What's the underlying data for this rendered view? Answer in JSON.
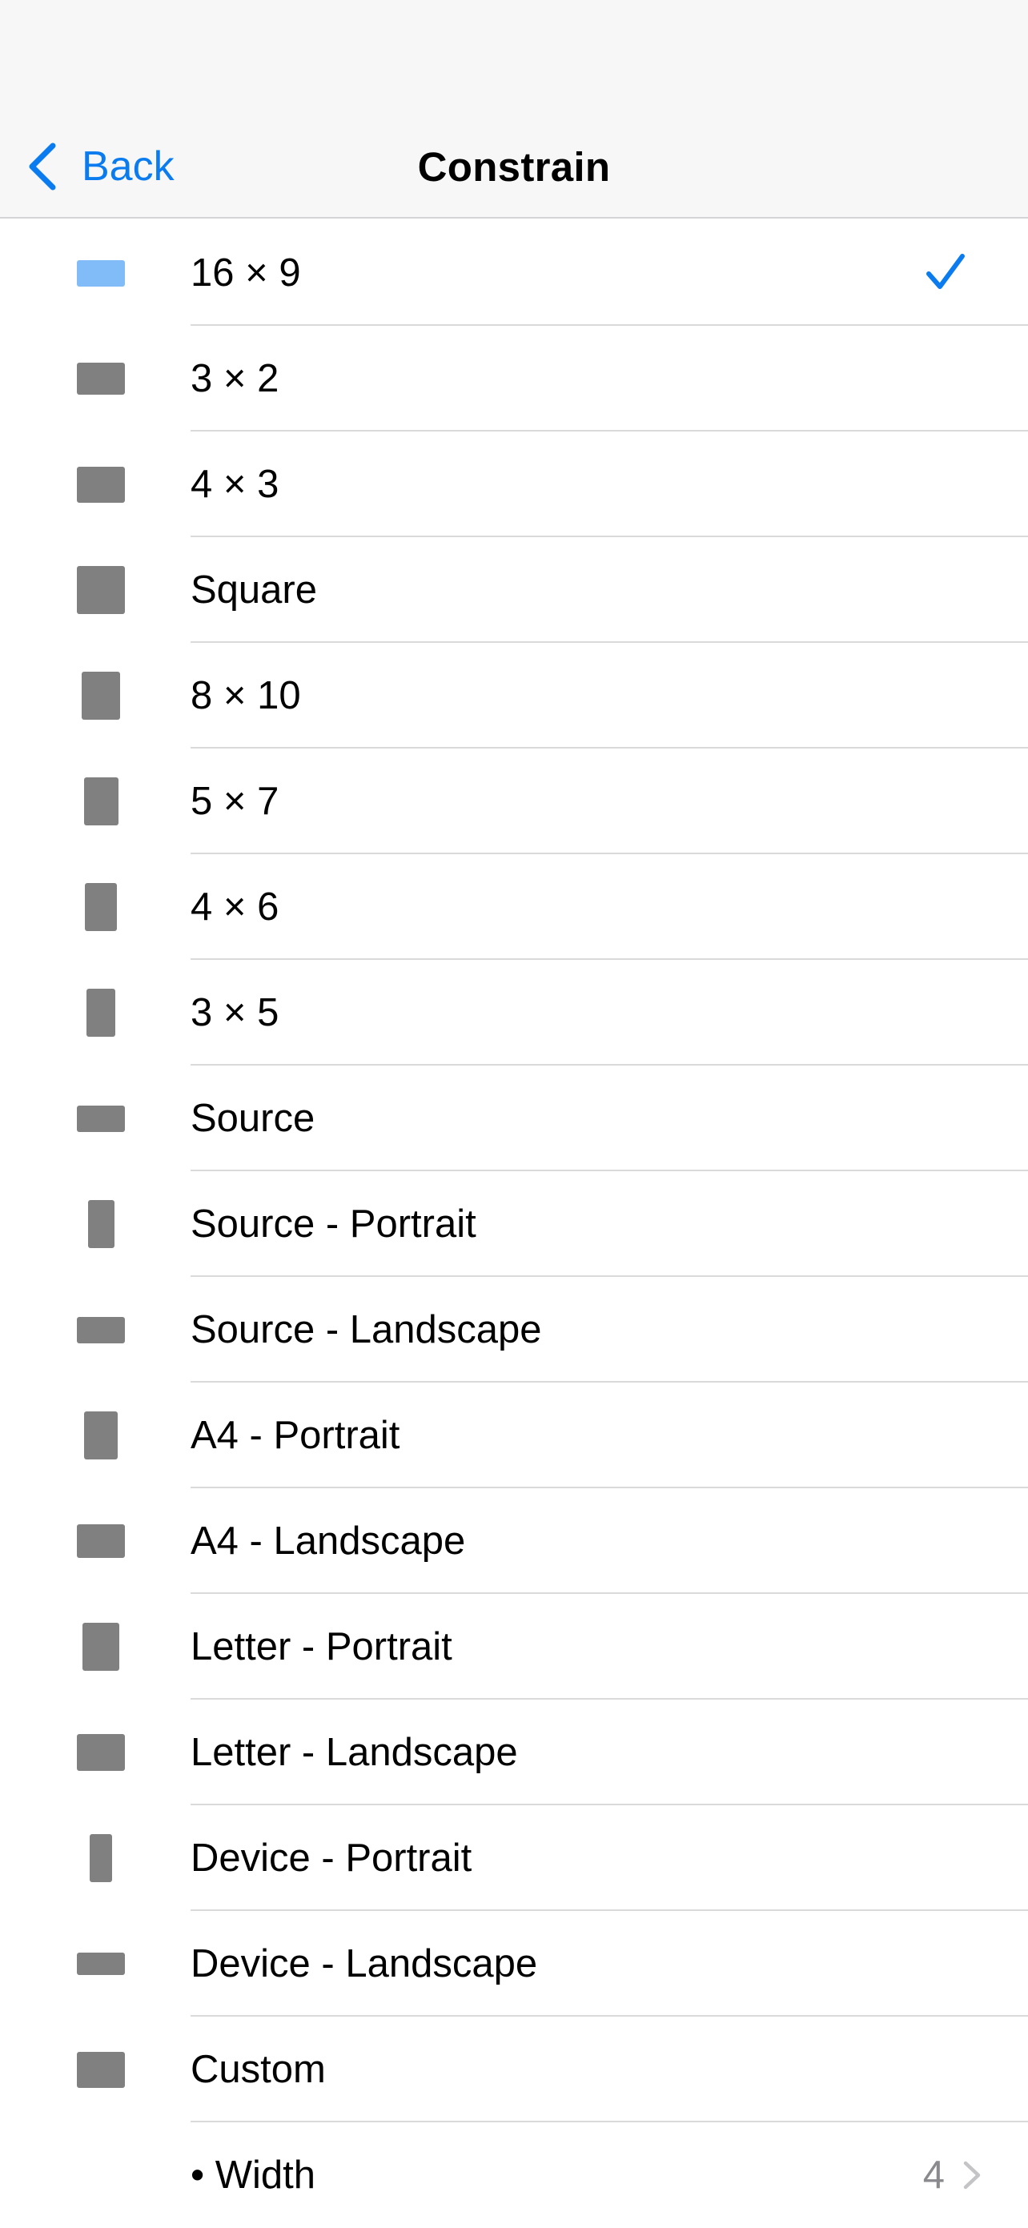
{
  "navbar": {
    "back_label": "Back",
    "title": "Constrain"
  },
  "colors": {
    "accent": "#0a7cf0",
    "shape": "#808080",
    "shape_selected": "#82bcf8",
    "secondary_text": "#8a8a8e"
  },
  "list": {
    "selected_index": 0,
    "items": [
      {
        "label": "16 × 9",
        "icon": "aspect-16x9-icon"
      },
      {
        "label": "3 × 2",
        "icon": "aspect-3x2-icon"
      },
      {
        "label": "4 × 3",
        "icon": "aspect-4x3-icon"
      },
      {
        "label": "Square",
        "icon": "aspect-square-icon"
      },
      {
        "label": "8 × 10",
        "icon": "aspect-8x10-icon"
      },
      {
        "label": "5 × 7",
        "icon": "aspect-5x7-icon"
      },
      {
        "label": "4 × 6",
        "icon": "aspect-4x6-icon"
      },
      {
        "label": "3 × 5",
        "icon": "aspect-3x5-icon"
      },
      {
        "label": "Source",
        "icon": "aspect-source-icon"
      },
      {
        "label": "Source - Portrait",
        "icon": "aspect-source-portrait-icon"
      },
      {
        "label": "Source - Landscape",
        "icon": "aspect-source-landscape-icon"
      },
      {
        "label": "A4 - Portrait",
        "icon": "aspect-a4-portrait-icon"
      },
      {
        "label": "A4 - Landscape",
        "icon": "aspect-a4-landscape-icon"
      },
      {
        "label": "Letter - Portrait",
        "icon": "aspect-letter-portrait-icon"
      },
      {
        "label": "Letter - Landscape",
        "icon": "aspect-letter-landscape-icon"
      },
      {
        "label": "Device - Portrait",
        "icon": "aspect-device-portrait-icon"
      },
      {
        "label": "Device - Landscape",
        "icon": "aspect-device-landscape-icon"
      },
      {
        "label": "Custom",
        "icon": "aspect-custom-icon"
      }
    ],
    "custom_width": {
      "label": "• Width",
      "value": "4"
    }
  }
}
